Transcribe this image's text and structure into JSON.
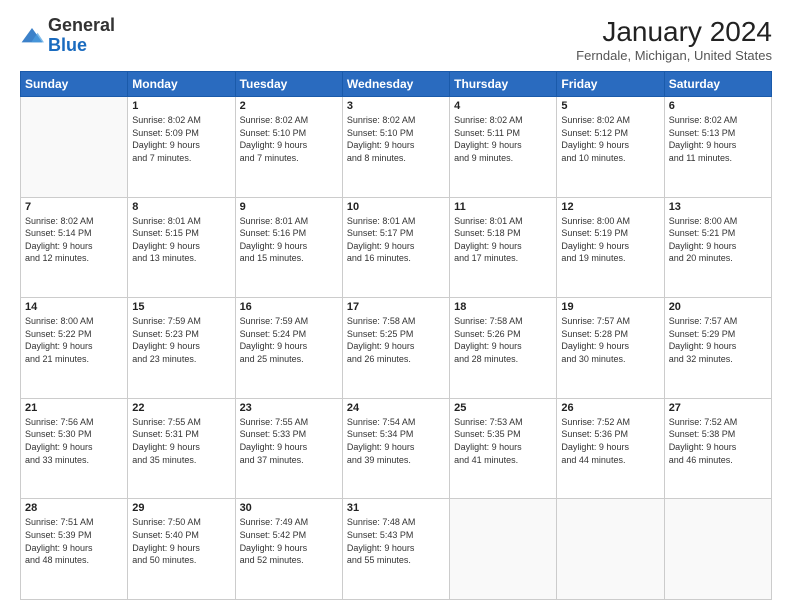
{
  "header": {
    "logo_general": "General",
    "logo_blue": "Blue",
    "month_year": "January 2024",
    "location": "Ferndale, Michigan, United States"
  },
  "days_of_week": [
    "Sunday",
    "Monday",
    "Tuesday",
    "Wednesday",
    "Thursday",
    "Friday",
    "Saturday"
  ],
  "weeks": [
    [
      {
        "day": "",
        "info": ""
      },
      {
        "day": "1",
        "info": "Sunrise: 8:02 AM\nSunset: 5:09 PM\nDaylight: 9 hours\nand 7 minutes."
      },
      {
        "day": "2",
        "info": "Sunrise: 8:02 AM\nSunset: 5:10 PM\nDaylight: 9 hours\nand 7 minutes."
      },
      {
        "day": "3",
        "info": "Sunrise: 8:02 AM\nSunset: 5:10 PM\nDaylight: 9 hours\nand 8 minutes."
      },
      {
        "day": "4",
        "info": "Sunrise: 8:02 AM\nSunset: 5:11 PM\nDaylight: 9 hours\nand 9 minutes."
      },
      {
        "day": "5",
        "info": "Sunrise: 8:02 AM\nSunset: 5:12 PM\nDaylight: 9 hours\nand 10 minutes."
      },
      {
        "day": "6",
        "info": "Sunrise: 8:02 AM\nSunset: 5:13 PM\nDaylight: 9 hours\nand 11 minutes."
      }
    ],
    [
      {
        "day": "7",
        "info": "Sunrise: 8:02 AM\nSunset: 5:14 PM\nDaylight: 9 hours\nand 12 minutes."
      },
      {
        "day": "8",
        "info": "Sunrise: 8:01 AM\nSunset: 5:15 PM\nDaylight: 9 hours\nand 13 minutes."
      },
      {
        "day": "9",
        "info": "Sunrise: 8:01 AM\nSunset: 5:16 PM\nDaylight: 9 hours\nand 15 minutes."
      },
      {
        "day": "10",
        "info": "Sunrise: 8:01 AM\nSunset: 5:17 PM\nDaylight: 9 hours\nand 16 minutes."
      },
      {
        "day": "11",
        "info": "Sunrise: 8:01 AM\nSunset: 5:18 PM\nDaylight: 9 hours\nand 17 minutes."
      },
      {
        "day": "12",
        "info": "Sunrise: 8:00 AM\nSunset: 5:19 PM\nDaylight: 9 hours\nand 19 minutes."
      },
      {
        "day": "13",
        "info": "Sunrise: 8:00 AM\nSunset: 5:21 PM\nDaylight: 9 hours\nand 20 minutes."
      }
    ],
    [
      {
        "day": "14",
        "info": "Sunrise: 8:00 AM\nSunset: 5:22 PM\nDaylight: 9 hours\nand 21 minutes."
      },
      {
        "day": "15",
        "info": "Sunrise: 7:59 AM\nSunset: 5:23 PM\nDaylight: 9 hours\nand 23 minutes."
      },
      {
        "day": "16",
        "info": "Sunrise: 7:59 AM\nSunset: 5:24 PM\nDaylight: 9 hours\nand 25 minutes."
      },
      {
        "day": "17",
        "info": "Sunrise: 7:58 AM\nSunset: 5:25 PM\nDaylight: 9 hours\nand 26 minutes."
      },
      {
        "day": "18",
        "info": "Sunrise: 7:58 AM\nSunset: 5:26 PM\nDaylight: 9 hours\nand 28 minutes."
      },
      {
        "day": "19",
        "info": "Sunrise: 7:57 AM\nSunset: 5:28 PM\nDaylight: 9 hours\nand 30 minutes."
      },
      {
        "day": "20",
        "info": "Sunrise: 7:57 AM\nSunset: 5:29 PM\nDaylight: 9 hours\nand 32 minutes."
      }
    ],
    [
      {
        "day": "21",
        "info": "Sunrise: 7:56 AM\nSunset: 5:30 PM\nDaylight: 9 hours\nand 33 minutes."
      },
      {
        "day": "22",
        "info": "Sunrise: 7:55 AM\nSunset: 5:31 PM\nDaylight: 9 hours\nand 35 minutes."
      },
      {
        "day": "23",
        "info": "Sunrise: 7:55 AM\nSunset: 5:33 PM\nDaylight: 9 hours\nand 37 minutes."
      },
      {
        "day": "24",
        "info": "Sunrise: 7:54 AM\nSunset: 5:34 PM\nDaylight: 9 hours\nand 39 minutes."
      },
      {
        "day": "25",
        "info": "Sunrise: 7:53 AM\nSunset: 5:35 PM\nDaylight: 9 hours\nand 41 minutes."
      },
      {
        "day": "26",
        "info": "Sunrise: 7:52 AM\nSunset: 5:36 PM\nDaylight: 9 hours\nand 44 minutes."
      },
      {
        "day": "27",
        "info": "Sunrise: 7:52 AM\nSunset: 5:38 PM\nDaylight: 9 hours\nand 46 minutes."
      }
    ],
    [
      {
        "day": "28",
        "info": "Sunrise: 7:51 AM\nSunset: 5:39 PM\nDaylight: 9 hours\nand 48 minutes."
      },
      {
        "day": "29",
        "info": "Sunrise: 7:50 AM\nSunset: 5:40 PM\nDaylight: 9 hours\nand 50 minutes."
      },
      {
        "day": "30",
        "info": "Sunrise: 7:49 AM\nSunset: 5:42 PM\nDaylight: 9 hours\nand 52 minutes."
      },
      {
        "day": "31",
        "info": "Sunrise: 7:48 AM\nSunset: 5:43 PM\nDaylight: 9 hours\nand 55 minutes."
      },
      {
        "day": "",
        "info": ""
      },
      {
        "day": "",
        "info": ""
      },
      {
        "day": "",
        "info": ""
      }
    ]
  ]
}
